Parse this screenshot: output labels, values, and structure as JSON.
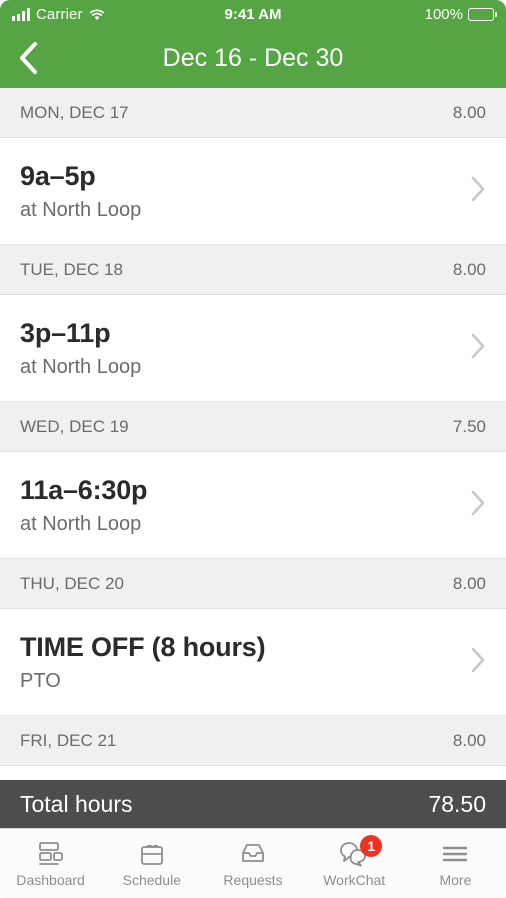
{
  "status_bar": {
    "carrier": "Carrier",
    "time": "9:41 AM",
    "battery_percent": "100%",
    "signal_icon": "signal-bars-icon",
    "wifi_icon": "wifi-icon",
    "battery_icon": "battery-full-icon"
  },
  "nav": {
    "back_icon": "chevron-left-icon",
    "title": "Dec 16 - Dec 30"
  },
  "schedule": {
    "days": [
      {
        "date_label": "MON, DEC 17",
        "hours": "8.00",
        "entry": {
          "title": "9a–5p",
          "subtitle": "at North Loop"
        }
      },
      {
        "date_label": "TUE, DEC 18",
        "hours": "8.00",
        "entry": {
          "title": "3p–11p",
          "subtitle": "at North Loop"
        }
      },
      {
        "date_label": "WED, DEC 19",
        "hours": "7.50",
        "entry": {
          "title": "11a–6:30p",
          "subtitle": "at North Loop"
        }
      },
      {
        "date_label": "THU, DEC 20",
        "hours": "8.00",
        "entry": {
          "title": "TIME OFF (8 hours)",
          "subtitle": "PTO"
        }
      },
      {
        "date_label": "FRI, DEC 21",
        "hours": "8.00",
        "entry": null
      }
    ]
  },
  "total": {
    "label": "Total hours",
    "value": "78.50"
  },
  "tabbar": {
    "items": [
      {
        "label": "Dashboard",
        "icon": "dashboard-icon"
      },
      {
        "label": "Schedule",
        "icon": "calendar-icon"
      },
      {
        "label": "Requests",
        "icon": "inbox-tray-icon"
      },
      {
        "label": "WorkChat",
        "icon": "chat-bubbles-icon",
        "badge": "1"
      },
      {
        "label": "More",
        "icon": "hamburger-menu-icon"
      }
    ]
  },
  "colors": {
    "brand_green": "#55a544",
    "total_bar": "#4d4d4d",
    "badge_red": "#ee3124",
    "header_gray": "#f0f0f0"
  }
}
